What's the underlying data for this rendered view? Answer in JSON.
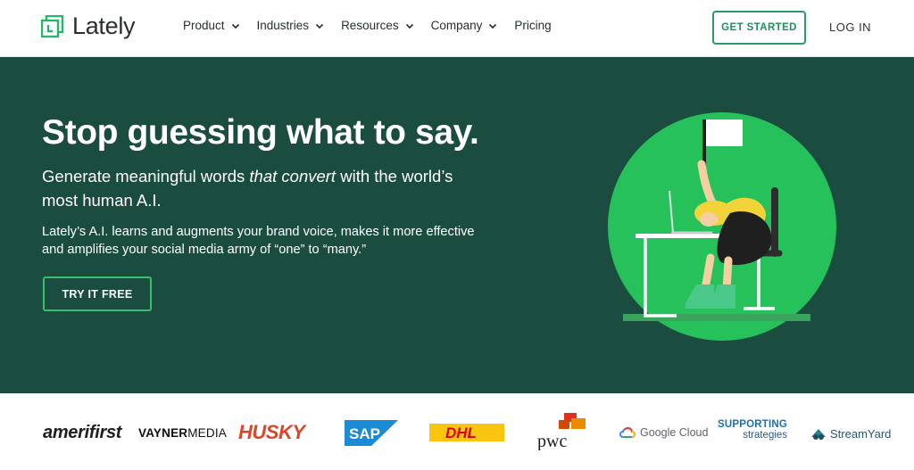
{
  "nav": {
    "logo_text": "Lately",
    "menu": [
      {
        "label": "Product",
        "has_dropdown": true
      },
      {
        "label": "Industries",
        "has_dropdown": true
      },
      {
        "label": "Resources",
        "has_dropdown": true
      },
      {
        "label": "Company",
        "has_dropdown": true
      },
      {
        "label": "Pricing",
        "has_dropdown": false
      }
    ],
    "get_started": "GET STARTED",
    "login": "LOG IN"
  },
  "hero": {
    "headline": "Stop guessing what to say.",
    "sub_pre": "Generate meaningful words ",
    "sub_em": "that convert",
    "sub_post": " with the world’s most human A.I.",
    "body": "Lately’s A.I. learns and augments your brand voice, makes it more effective and amplifies your social media army of “one” to “many.”",
    "cta": "TRY IT FREE",
    "illustration": "person-slumped-at-desk-waving-white-flag"
  },
  "clients": {
    "amerifirst": "amerifirst",
    "vayner_a": "VAYNER",
    "vayner_b": "MEDIA",
    "husky": "HUSKY",
    "sap": "SAP",
    "dhl": "DHL",
    "pwc": "pwc",
    "google_cloud": "Google Cloud",
    "supporting_1": "SUPPORTING",
    "supporting_2": "strategies",
    "streamyard": "StreamYard"
  },
  "colors": {
    "brand_green": "#2a9a6a",
    "hero_bg": "#1a4d40",
    "accent_green": "#27c15c",
    "cta_border": "#39c06f"
  }
}
